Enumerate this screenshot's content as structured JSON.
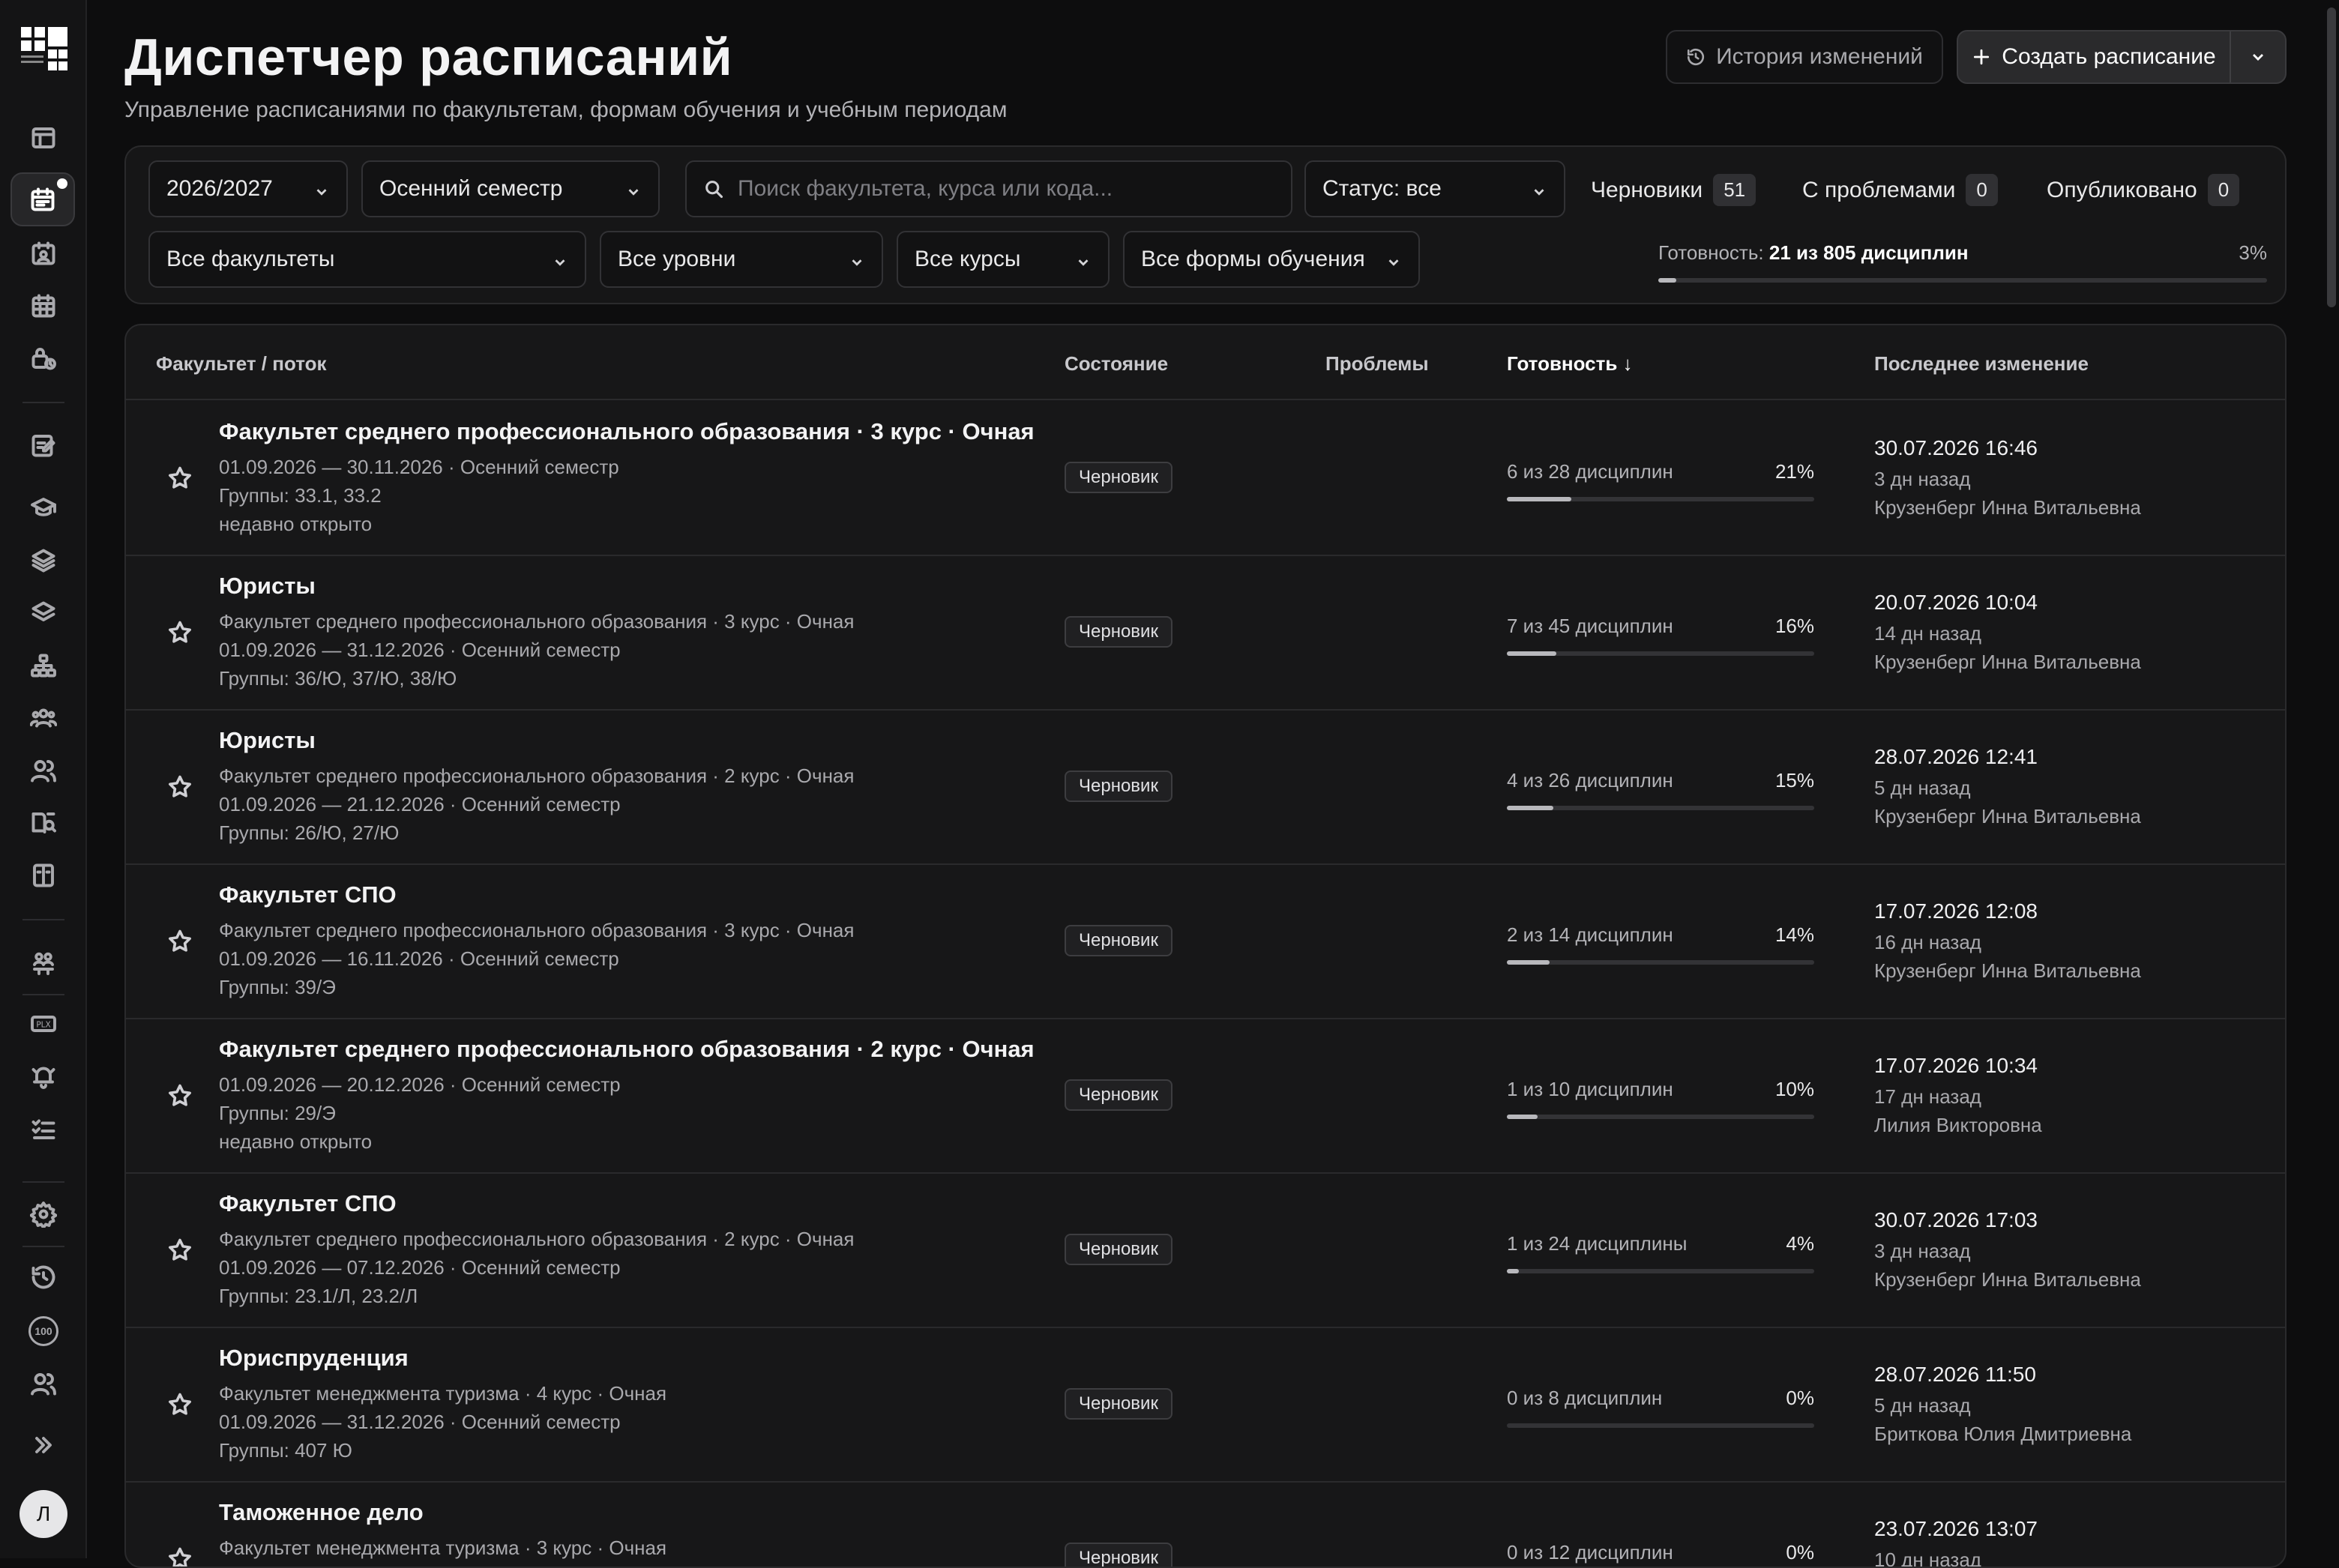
{
  "header": {
    "title": "Диспетчер расписаний",
    "subtitle": "Управление расписаниями по факультетам, формам обучения и учебным периодам",
    "history_label": "История изменений",
    "create_label": "Создать расписание"
  },
  "sidebar": {
    "avatar_initial": "Л",
    "badge_100": "100"
  },
  "filters": {
    "year": "2026/2027",
    "semester": "Осенний семестр",
    "search_placeholder": "Поиск факультета, курса или кода...",
    "status": "Статус: все",
    "faculty": "Все факультеты",
    "level": "Все уровни",
    "course": "Все курсы",
    "form": "Все формы обучения",
    "counters": {
      "drafts_label": "Черновики",
      "drafts_count": "51",
      "problems_label": "С проблемами",
      "problems_count": "0",
      "published_label": "Опубликовано",
      "published_count": "0"
    },
    "readiness": {
      "label": "Готовность:",
      "value": "21 из 805 дисциплин",
      "percent": "3%",
      "fraction": 0.03
    }
  },
  "table": {
    "columns": {
      "faculty": "Факультет / поток",
      "state": "Состояние",
      "problems": "Проблемы",
      "readiness": "Готовность ↓",
      "changed": "Последнее изменение"
    },
    "rows": [
      {
        "title": "Факультет среднего профессионального образования · 3 курс · Очная",
        "lines": [
          "01.09.2026 — 30.11.2026 · Осенний семестр",
          "Группы: 33.1, 33.2",
          "недавно открыто"
        ],
        "status": "Черновик",
        "progress_text": "6 из 28 дисциплин",
        "progress_pct": "21%",
        "progress_fraction": 0.21,
        "date": "30.07.2026 16:46",
        "ago": "3 дн назад",
        "author": "Крузенберг Инна Витальевна"
      },
      {
        "title": "Юристы",
        "lines": [
          "Факультет среднего профессионального образования · 3 курс · Очная",
          "01.09.2026 — 31.12.2026 · Осенний семестр",
          "Группы: 36/Ю, 37/Ю, 38/Ю"
        ],
        "status": "Черновик",
        "progress_text": "7 из 45 дисциплин",
        "progress_pct": "16%",
        "progress_fraction": 0.16,
        "date": "20.07.2026 10:04",
        "ago": "14 дн назад",
        "author": "Крузенберг Инна Витальевна"
      },
      {
        "title": "Юристы",
        "lines": [
          "Факультет среднего профессионального образования · 2 курс · Очная",
          "01.09.2026 — 21.12.2026 · Осенний семестр",
          "Группы: 26/Ю, 27/Ю"
        ],
        "status": "Черновик",
        "progress_text": "4 из 26 дисциплин",
        "progress_pct": "15%",
        "progress_fraction": 0.15,
        "date": "28.07.2026 12:41",
        "ago": "5 дн назад",
        "author": "Крузенберг Инна Витальевна"
      },
      {
        "title": "Факультет СПО",
        "lines": [
          "Факультет среднего профессионального образования · 3 курс · Очная",
          "01.09.2026 — 16.11.2026 · Осенний семестр",
          "Группы: 39/Э"
        ],
        "status": "Черновик",
        "progress_text": "2 из 14 дисциплин",
        "progress_pct": "14%",
        "progress_fraction": 0.14,
        "date": "17.07.2026 12:08",
        "ago": "16 дн назад",
        "author": "Крузенберг Инна Витальевна"
      },
      {
        "title": "Факультет среднего профессионального образования · 2 курс · Очная",
        "lines": [
          "01.09.2026 — 20.12.2026 · Осенний семестр",
          "Группы: 29/Э",
          "недавно открыто"
        ],
        "status": "Черновик",
        "progress_text": "1 из 10 дисциплин",
        "progress_pct": "10%",
        "progress_fraction": 0.1,
        "date": "17.07.2026 10:34",
        "ago": "17 дн назад",
        "author": "Лилия Викторовна"
      },
      {
        "title": "Факультет СПО",
        "lines": [
          "Факультет среднего профессионального образования · 2 курс · Очная",
          "01.09.2026 — 07.12.2026 · Осенний семестр",
          "Группы: 23.1/Л, 23.2/Л"
        ],
        "status": "Черновик",
        "progress_text": "1 из 24 дисциплины",
        "progress_pct": "4%",
        "progress_fraction": 0.04,
        "date": "30.07.2026 17:03",
        "ago": "3 дн назад",
        "author": "Крузенберг Инна Витальевна"
      },
      {
        "title": "Юриспруденция",
        "lines": [
          "Факультет менеджмента туризма · 4 курс · Очная",
          "01.09.2026 — 31.12.2026 · Осенний семестр",
          "Группы: 407 Ю"
        ],
        "status": "Черновик",
        "progress_text": "0 из 8 дисциплин",
        "progress_pct": "0%",
        "progress_fraction": 0.0,
        "date": "28.07.2026 11:50",
        "ago": "5 дн назад",
        "author": "Бриткова Юлия Дмитриевна"
      },
      {
        "title": "Таможенное дело",
        "lines": [
          "Факультет менеджмента туризма · 3 курс · Очная",
          "",
          ""
        ],
        "status": "Черновик",
        "progress_text": "0 из 12 дисциплин",
        "progress_pct": "0%",
        "progress_fraction": 0.0,
        "date": "23.07.2026 13:07",
        "ago": "10 дн назад",
        "author": ""
      }
    ]
  }
}
